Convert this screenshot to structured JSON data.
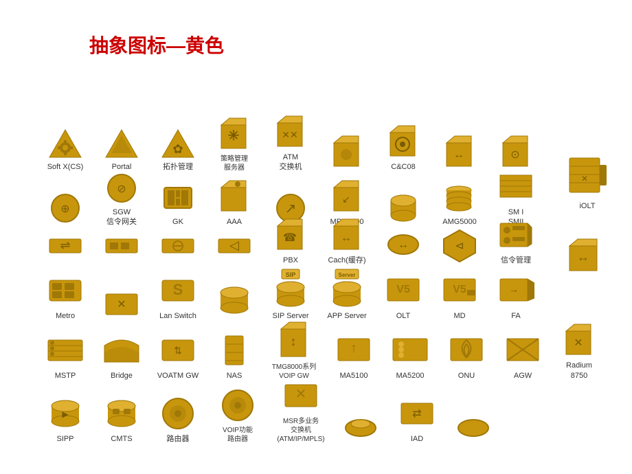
{
  "title": "抽象图标—黄色",
  "rows": [
    {
      "items": [
        {
          "id": "softx",
          "label": "Soft X(CS)"
        },
        {
          "id": "portal",
          "label": "Portal"
        },
        {
          "id": "topology",
          "label": "拓扑管理"
        },
        {
          "id": "policy",
          "label": "策略管理\n服务器"
        },
        {
          "id": "atm",
          "label": "ATM\n交换机"
        },
        {
          "id": "unknown1",
          "label": ""
        },
        {
          "id": "cc08",
          "label": "C&C08"
        },
        {
          "id": "unknown2",
          "label": ""
        },
        {
          "id": "unknown3",
          "label": ""
        }
      ]
    },
    {
      "items": [
        {
          "id": "unknown4",
          "label": ""
        },
        {
          "id": "sgw",
          "label": "SGW\n信令网关"
        },
        {
          "id": "gk",
          "label": "GK"
        },
        {
          "id": "aaa",
          "label": "AAA"
        },
        {
          "id": "unknown5",
          "label": ""
        },
        {
          "id": "mrs6000",
          "label": "MRS6000"
        },
        {
          "id": "unknown6",
          "label": ""
        },
        {
          "id": "amg5000",
          "label": "AMG5000"
        },
        {
          "id": "smism2",
          "label": "SM I\nSMII"
        }
      ]
    },
    {
      "items": [
        {
          "id": "unknown7",
          "label": ""
        },
        {
          "id": "unknown8",
          "label": ""
        },
        {
          "id": "unknown9",
          "label": ""
        },
        {
          "id": "unknown10",
          "label": ""
        },
        {
          "id": "pbx",
          "label": "PBX"
        },
        {
          "id": "cache",
          "label": "Cach(缓存)"
        },
        {
          "id": "unknown11",
          "label": ""
        },
        {
          "id": "unknown12",
          "label": ""
        },
        {
          "id": "sigling",
          "label": "信令管理"
        }
      ]
    },
    {
      "items": [
        {
          "id": "metro",
          "label": "Metro"
        },
        {
          "id": "unknown13",
          "label": ""
        },
        {
          "id": "lanswitch",
          "label": "Lan Switch"
        },
        {
          "id": "unknown14",
          "label": ""
        },
        {
          "id": "sipserver",
          "label": "SIP Server"
        },
        {
          "id": "appserver",
          "label": "APP Server"
        },
        {
          "id": "olt",
          "label": "OLT"
        },
        {
          "id": "md",
          "label": "MD"
        },
        {
          "id": "fa",
          "label": "FA"
        }
      ]
    },
    {
      "items": [
        {
          "id": "mstp",
          "label": "MSTP"
        },
        {
          "id": "bridge",
          "label": "Bridge"
        },
        {
          "id": "voatmgw",
          "label": "VOATM GW"
        },
        {
          "id": "nas",
          "label": "NAS"
        },
        {
          "id": "tmg8000",
          "label": "TMG8000系列\nVOIP GW"
        },
        {
          "id": "ma5100",
          "label": "MA5100"
        },
        {
          "id": "ma5200",
          "label": "MA5200"
        },
        {
          "id": "onu",
          "label": "ONU"
        },
        {
          "id": "agw",
          "label": "AGW"
        },
        {
          "id": "radium8750",
          "label": "Radium\n8750"
        }
      ]
    },
    {
      "items": [
        {
          "id": "sipp",
          "label": "SIPP"
        },
        {
          "id": "cmts",
          "label": "CMTS"
        },
        {
          "id": "router",
          "label": "路由器"
        },
        {
          "id": "voipfunc",
          "label": "VOIP功能\n路由器"
        },
        {
          "id": "msr",
          "label": "MSR多业务\n交换机\n(ATM/IP/MPLS)"
        },
        {
          "id": "unknown15",
          "label": ""
        },
        {
          "id": "iad",
          "label": "IAD"
        },
        {
          "id": "unknown16",
          "label": ""
        }
      ]
    }
  ],
  "right_icons": [
    {
      "id": "iolt",
      "label": "iOLT"
    },
    {
      "id": "special",
      "label": ""
    }
  ],
  "colors": {
    "gold": "#C8960C",
    "gold_dark": "#A07808",
    "gold_light": "#E0B030",
    "red_title": "#CC0000"
  }
}
